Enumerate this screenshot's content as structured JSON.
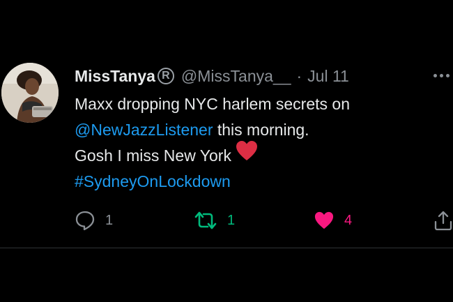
{
  "tweet": {
    "display_name": "MissTanya",
    "badge_symbol": "R",
    "handle": "@MissTanya__",
    "separator": "·",
    "date": "Jul 11",
    "text": {
      "line1": "Maxx dropping NYC harlem secrets on",
      "mention": "@NewJazzListener",
      "line2_rest": " this morning.",
      "line3": "Gosh I miss New York",
      "hashtag": "#SydneyOnLockdown"
    },
    "actions": {
      "reply_count": "1",
      "retweet_count": "1",
      "like_count": "4"
    }
  },
  "icons": {
    "more": "more-horizontal-icon",
    "reply": "reply-bubble-icon",
    "retweet": "retweet-icon",
    "like": "heart-icon",
    "share": "share-icon",
    "emoji": "red-heart-emoji"
  },
  "colors": {
    "background": "#000000",
    "primary_text": "#e7e9ea",
    "secondary_text": "#8b9096",
    "link": "#1d9bf0",
    "retweet_active": "#00ba7c",
    "like_active": "#f91880"
  }
}
